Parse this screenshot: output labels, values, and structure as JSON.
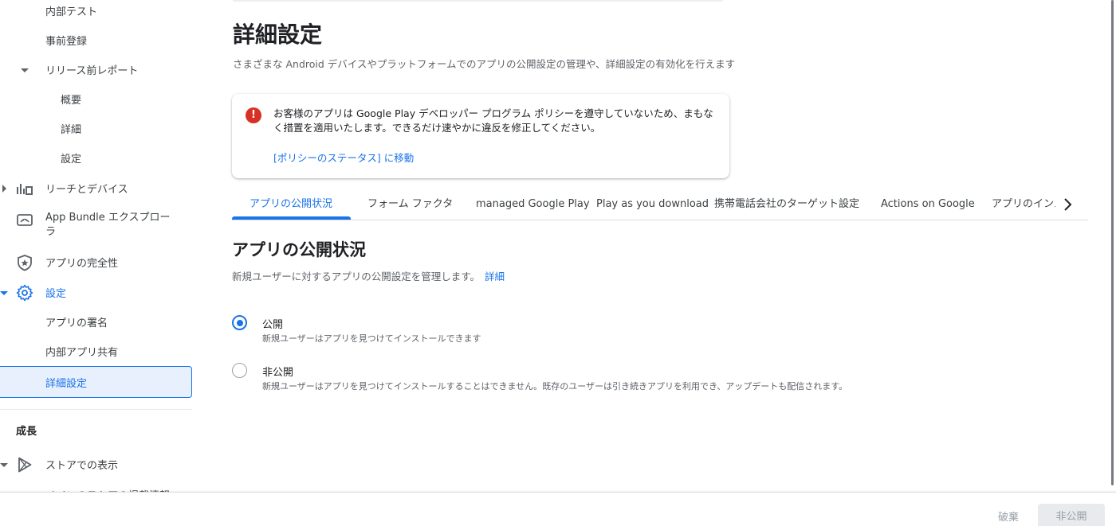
{
  "sidebar": {
    "items": [
      {
        "label": "内部テスト"
      },
      {
        "label": "事前登録"
      },
      {
        "label": "リリース前レポート"
      },
      {
        "label": "概要"
      },
      {
        "label": "詳細"
      },
      {
        "label": "設定"
      },
      {
        "label": "リーチとデバイス"
      },
      {
        "label": "App Bundle エクスプローラ"
      },
      {
        "label": "アプリの完全性"
      },
      {
        "label": "設定"
      },
      {
        "label": "アプリの署名"
      },
      {
        "label": "内部アプリ共有"
      },
      {
        "label": "詳細設定"
      }
    ],
    "growth_section": {
      "title": "成長",
      "items": [
        {
          "label": "ストアでの表示"
        },
        {
          "label": "メインのストアの掲載情報"
        }
      ]
    }
  },
  "header": {
    "title": "詳細設定",
    "description": "さまざまな Android デバイスやプラットフォームでのアプリの公開設定の管理や、詳細設定の有効化を行えます"
  },
  "alert": {
    "message": "お客様のアプリは Google Play デベロッパー プログラム ポリシーを遵守していないため、まもなく措置を適用いたします。できるだけ速やかに違反を修正してください。",
    "link": "[ポリシーのステータス] に移動"
  },
  "tabs": [
    {
      "label": "アプリの公開状況",
      "active": true
    },
    {
      "label": "フォーム ファクタ"
    },
    {
      "label": "managed Google Play"
    },
    {
      "label": "Play as you download"
    },
    {
      "label": "携帯電話会社のターゲット設定"
    },
    {
      "label": "Actions on Google"
    },
    {
      "label": "アプリのインスタント"
    }
  ],
  "visibility": {
    "title": "アプリの公開状況",
    "description": "新規ユーザーに対するアプリの公開設定を管理します。",
    "learn_more": "詳細",
    "options": [
      {
        "label": "公開",
        "sub": "新規ユーザーはアプリを見つけてインストールできます",
        "selected": true
      },
      {
        "label": "非公開",
        "sub": "新規ユーザーはアプリを見つけてインストールすることはできません。既存のユーザーは引き続きアプリを利用でき、アップデートも配信されます。",
        "selected": false
      }
    ]
  },
  "footer": {
    "discard_label": "破棄",
    "unpublish_label": "非公開"
  },
  "colors": {
    "accent": "#1a73e8",
    "error": "#d93025"
  }
}
